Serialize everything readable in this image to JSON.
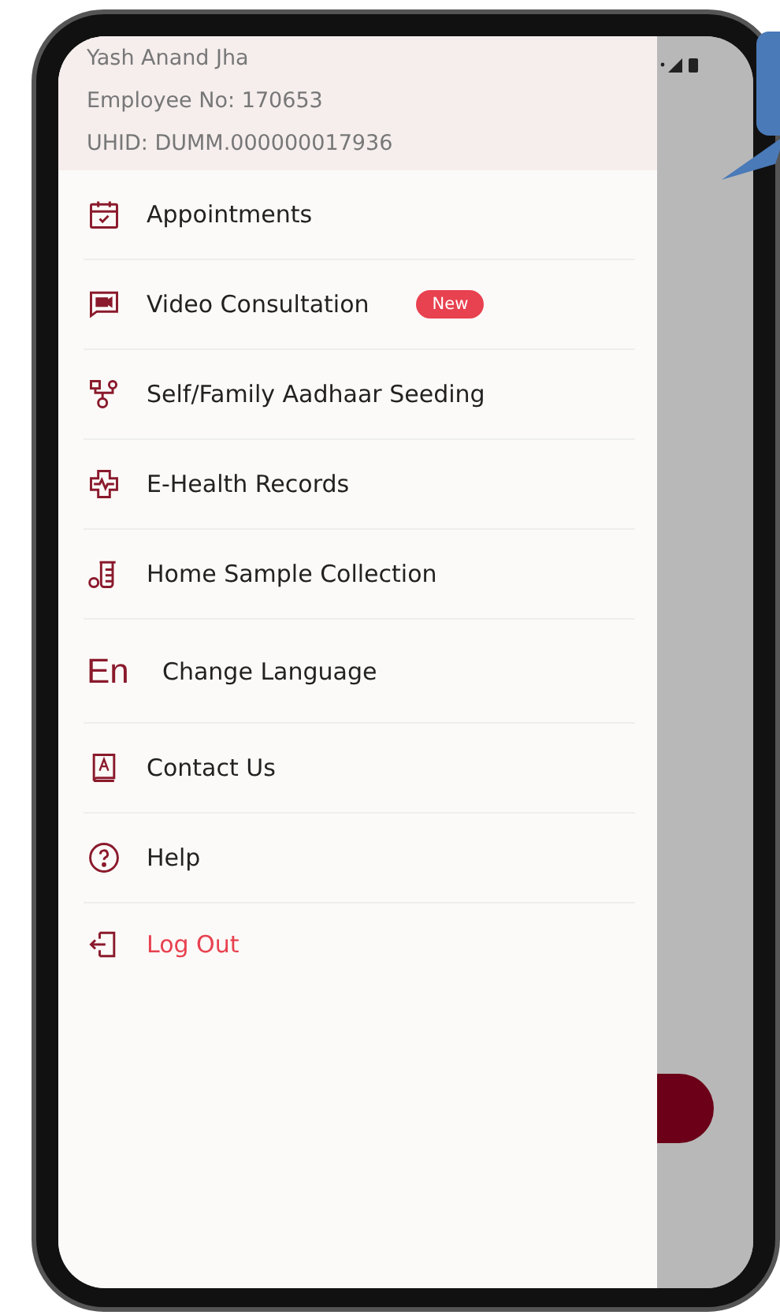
{
  "profile": {
    "name": "Yash Anand Jha",
    "employee_no": "Employee No: 170653",
    "uhid": "UHID: DUMM.000000017936"
  },
  "menu": [
    {
      "label": "Appointments",
      "kind": "link"
    },
    {
      "label": "Video Consultation",
      "kind": "link",
      "badge": "New"
    },
    {
      "label": "Self/Family Aadhaar Seeding",
      "kind": "link"
    },
    {
      "label": "E-Health Records",
      "kind": "link"
    },
    {
      "label": "Home Sample Collection",
      "kind": "link"
    },
    {
      "label": "Change Language",
      "kind": "language",
      "icon_text": "En"
    },
    {
      "label": "Contact Us",
      "kind": "link"
    },
    {
      "label": "Help",
      "kind": "link"
    },
    {
      "label": "Log Out",
      "kind": "logout"
    }
  ]
}
